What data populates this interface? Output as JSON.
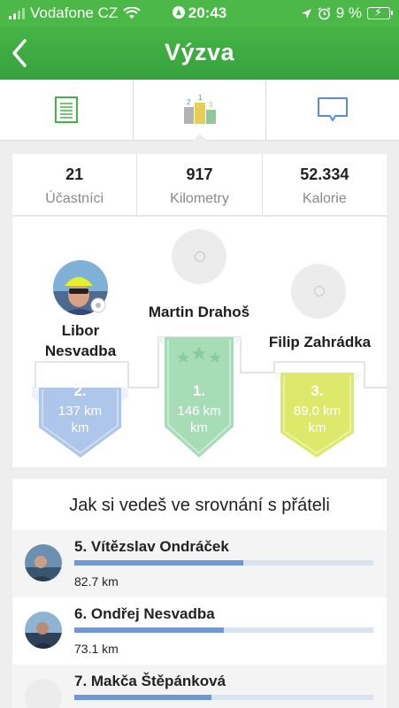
{
  "status": {
    "carrier": "Vodafone CZ",
    "time": "20:43",
    "battery": "9 %"
  },
  "nav": {
    "title": "Výzva"
  },
  "stats": [
    {
      "value": "21",
      "label": "Účastníci"
    },
    {
      "value": "917",
      "label": "Kilometry"
    },
    {
      "value": "52.334",
      "label": "Kalorie"
    }
  ],
  "podium": {
    "first": {
      "name": "Martin Drahoš",
      "place": "1.",
      "distance": "146 km",
      "unit": "km"
    },
    "second": {
      "name_line1": "Libor",
      "name_line2": "Nesvadba",
      "place": "2.",
      "distance": "137 km",
      "unit": "km"
    },
    "third": {
      "name": "Filip Zahrádka",
      "place": "3.",
      "distance": "89.0 km",
      "unit": "km"
    }
  },
  "colors": {
    "green": "#3faa42",
    "blue_ribbon": "#adc6ea",
    "green_ribbon": "#a6dcb6",
    "yellow_ribbon": "#dde96a",
    "progress": "#6f99d6"
  },
  "friends": {
    "heading": "Jak si vedeš ve srovnání s přáteli",
    "items": [
      {
        "name": "5. Vítězslav Ondráček",
        "distance": "82.7 km",
        "progress": 0.565
      },
      {
        "name": "6. Ondřej Nesvadba",
        "distance": "73.1 km",
        "progress": 0.5
      },
      {
        "name": "7. Makča Štěpánková",
        "distance": "",
        "progress": 0.46
      }
    ]
  }
}
